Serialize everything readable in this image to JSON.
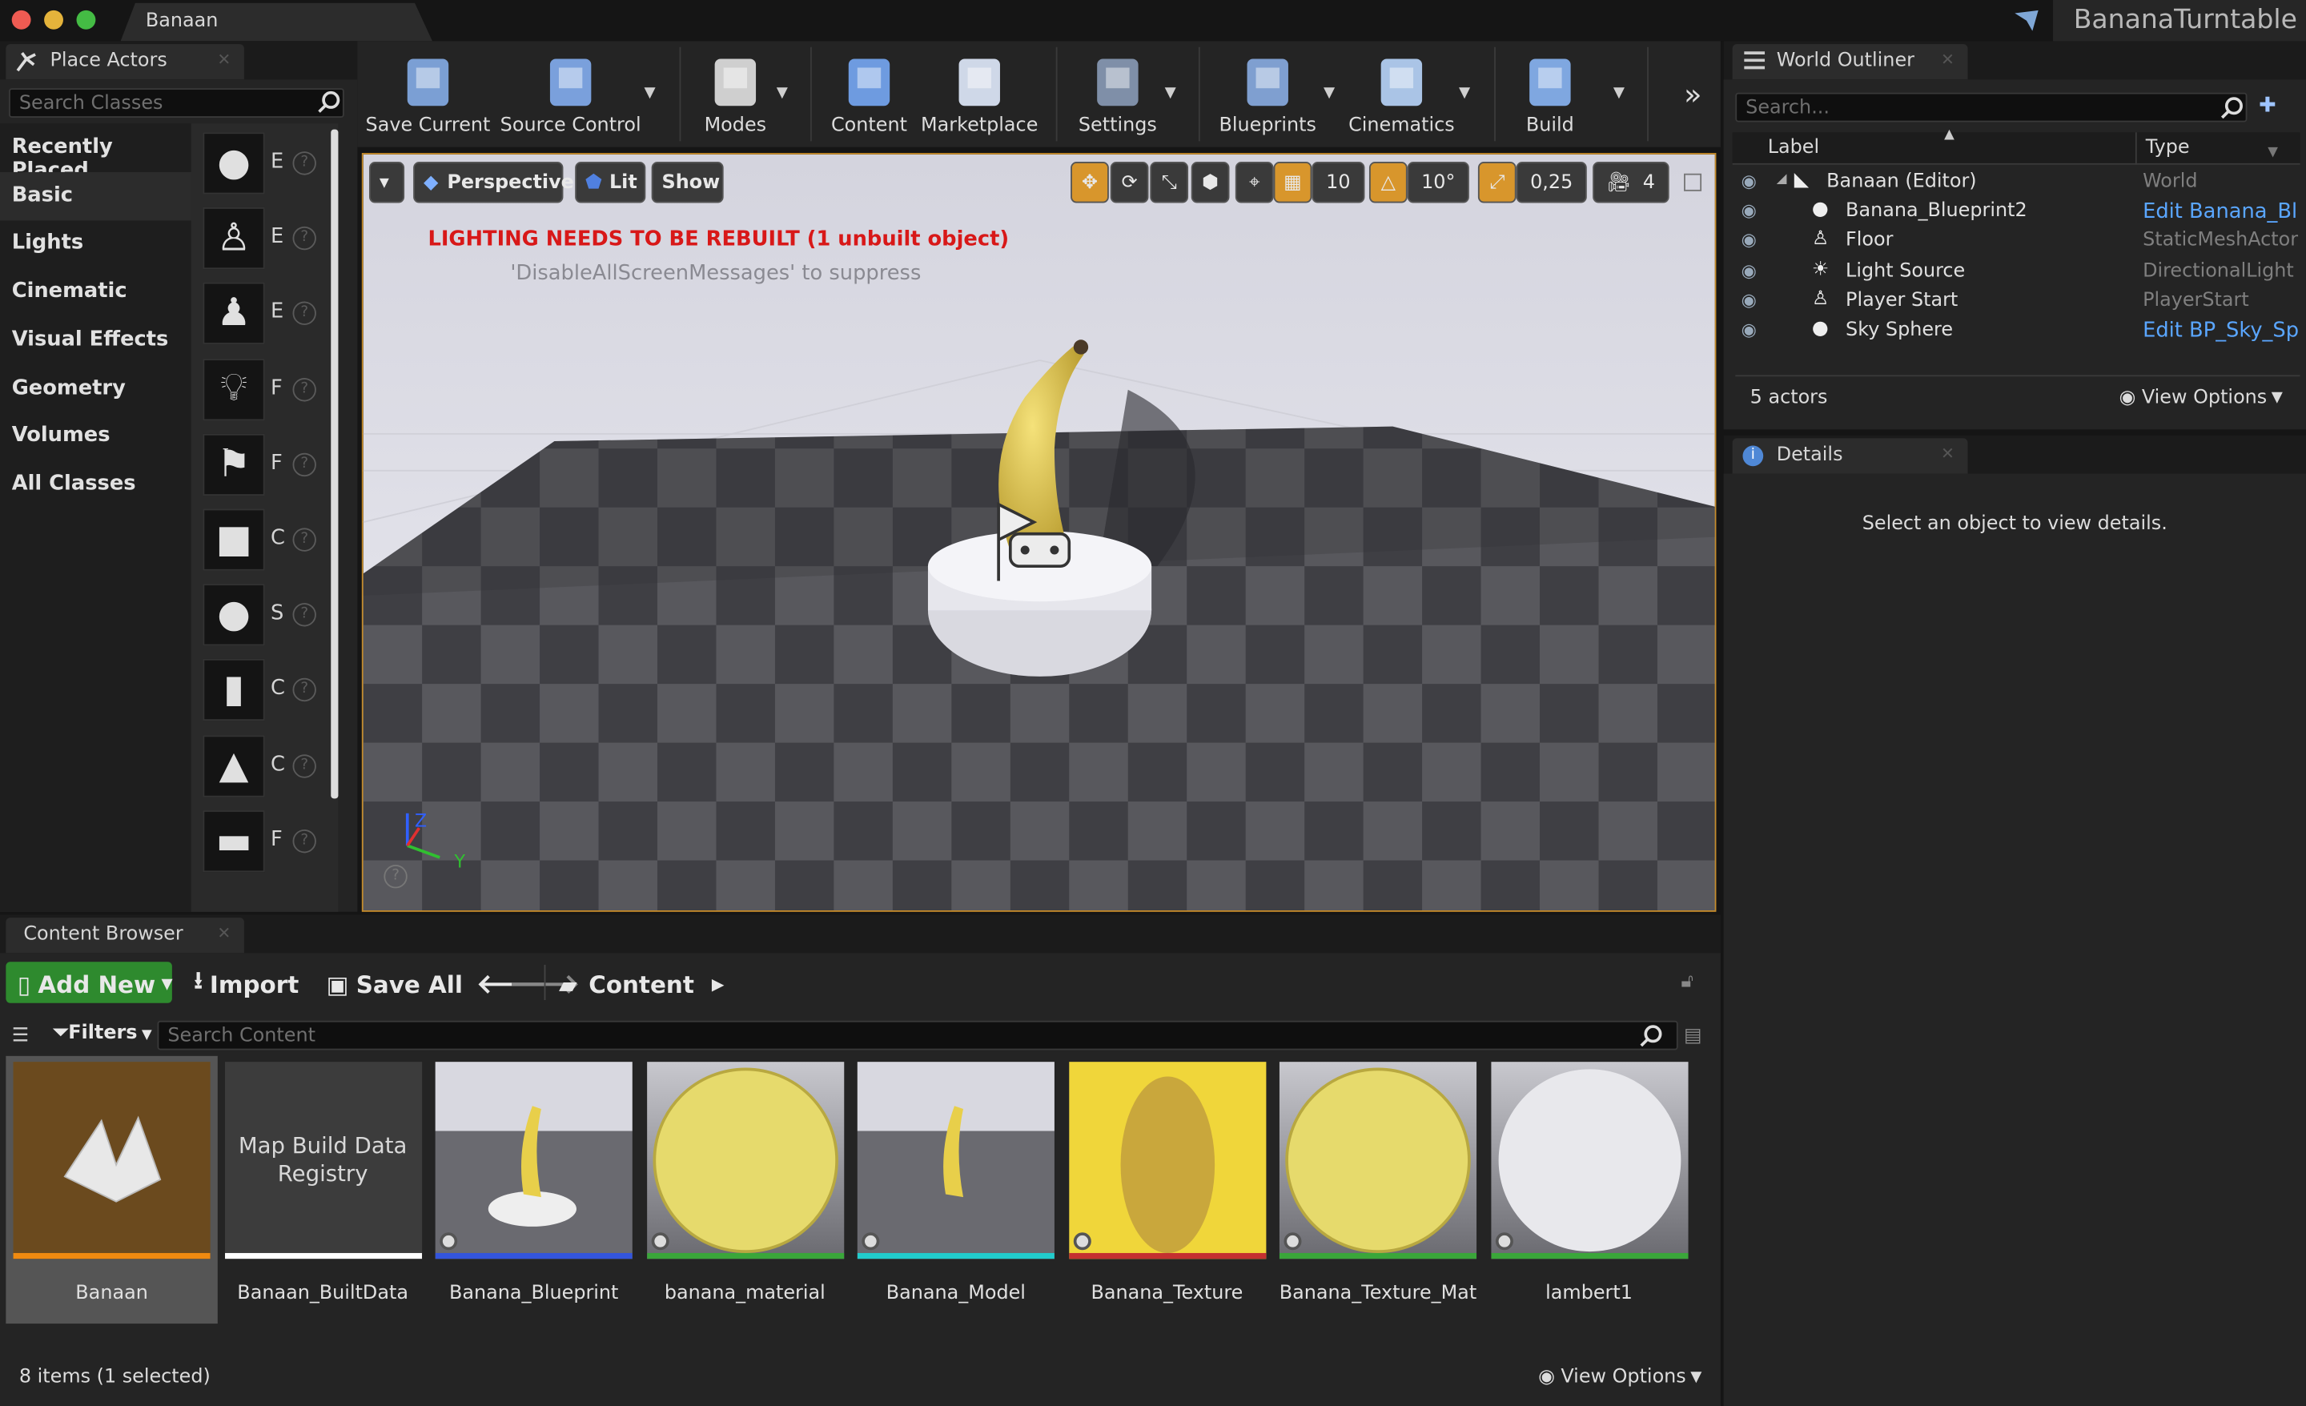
{
  "window": {
    "doc_tab": "Banaan",
    "project": "BananaTurntable"
  },
  "place_actors": {
    "tab": "Place Actors",
    "search_placeholder": "Search Classes",
    "categories": [
      "Recently Placed",
      "Basic",
      "Lights",
      "Cinematic",
      "Visual Effects",
      "Geometry",
      "Volumes",
      "All Classes"
    ],
    "selected_category": "Basic",
    "actor_letters": [
      "E",
      "E",
      "E",
      "F",
      "F",
      "C",
      "S",
      "C",
      "C",
      "F"
    ],
    "actor_icons": [
      "sphere-actor-icon",
      "character-actor-icon",
      "pawn-actor-icon",
      "point-light-icon",
      "player-start-icon",
      "cube-icon",
      "sphere-icon",
      "cylinder-icon",
      "cone-icon",
      "plane-icon"
    ]
  },
  "toolbar": {
    "items": [
      {
        "label": "Save Current",
        "icon": "save-icon"
      },
      {
        "label": "Source Control",
        "icon": "source-control-icon"
      },
      {
        "label": "Modes",
        "icon": "modes-icon"
      },
      {
        "label": "Content",
        "icon": "content-icon"
      },
      {
        "label": "Marketplace",
        "icon": "marketplace-icon"
      },
      {
        "label": "Settings",
        "icon": "settings-icon"
      },
      {
        "label": "Blueprints",
        "icon": "blueprints-icon"
      },
      {
        "label": "Cinematics",
        "icon": "cinematics-icon"
      },
      {
        "label": "Build",
        "icon": "build-icon"
      }
    ]
  },
  "viewport": {
    "perspective": "Perspective",
    "lit": "Lit",
    "show": "Show",
    "grid_snap": "10",
    "rot_snap": "10°",
    "scale_snap": "0,25",
    "cam_speed": "4",
    "warning": "LIGHTING NEEDS TO BE REBUILT (1 unbuilt object)",
    "suppress": "'DisableAllScreenMessages' to suppress",
    "axis_z": "Z",
    "axis_y": "Y",
    "colors": {
      "warning": "#ff1a1a",
      "accent": "#d8962c"
    }
  },
  "outliner": {
    "tab": "World Outliner",
    "search_placeholder": "Search...",
    "col_label": "Label",
    "col_type": "Type",
    "rows": [
      {
        "name": "Banaan (Editor)",
        "type": "World",
        "link": false
      },
      {
        "name": "Banana_Blueprint2",
        "type": "Edit Banana_Bl",
        "link": true
      },
      {
        "name": "Floor",
        "type": "StaticMeshActor",
        "link": false
      },
      {
        "name": "Light Source",
        "type": "DirectionalLight",
        "link": false
      },
      {
        "name": "Player Start",
        "type": "PlayerStart",
        "link": false
      },
      {
        "name": "Sky Sphere",
        "type": "Edit BP_Sky_Sp",
        "link": true
      }
    ],
    "count": "5 actors",
    "view_options": "View Options"
  },
  "details": {
    "tab": "Details",
    "empty": "Select an object to view details."
  },
  "content_browser": {
    "tab": "Content Browser",
    "add_new": "Add New",
    "import": "Import",
    "save_all": "Save All",
    "path": "Content",
    "filters": "Filters",
    "search_placeholder": "Search Content",
    "assets": [
      {
        "name": "Banaan",
        "thumb_text": "",
        "bar": "#f08a10"
      },
      {
        "name": "Banaan_BuiltData",
        "thumb_text": "Map Build Data Registry",
        "bar": "#ffffff"
      },
      {
        "name": "Banana_Blueprint",
        "thumb_text": "",
        "bar": "#3355dd"
      },
      {
        "name": "banana_material",
        "thumb_text": "",
        "bar": "#3aa63a"
      },
      {
        "name": "Banana_Model",
        "thumb_text": "",
        "bar": "#22cccc"
      },
      {
        "name": "Banana_Texture",
        "thumb_text": "",
        "bar": "#c43030"
      },
      {
        "name": "Banana_Texture_Mat",
        "thumb_text": "",
        "bar": "#3aa63a"
      },
      {
        "name": "lambert1",
        "thumb_text": "",
        "bar": "#3aa63a"
      }
    ],
    "status": "8 items (1 selected)",
    "view_options": "View Options"
  }
}
